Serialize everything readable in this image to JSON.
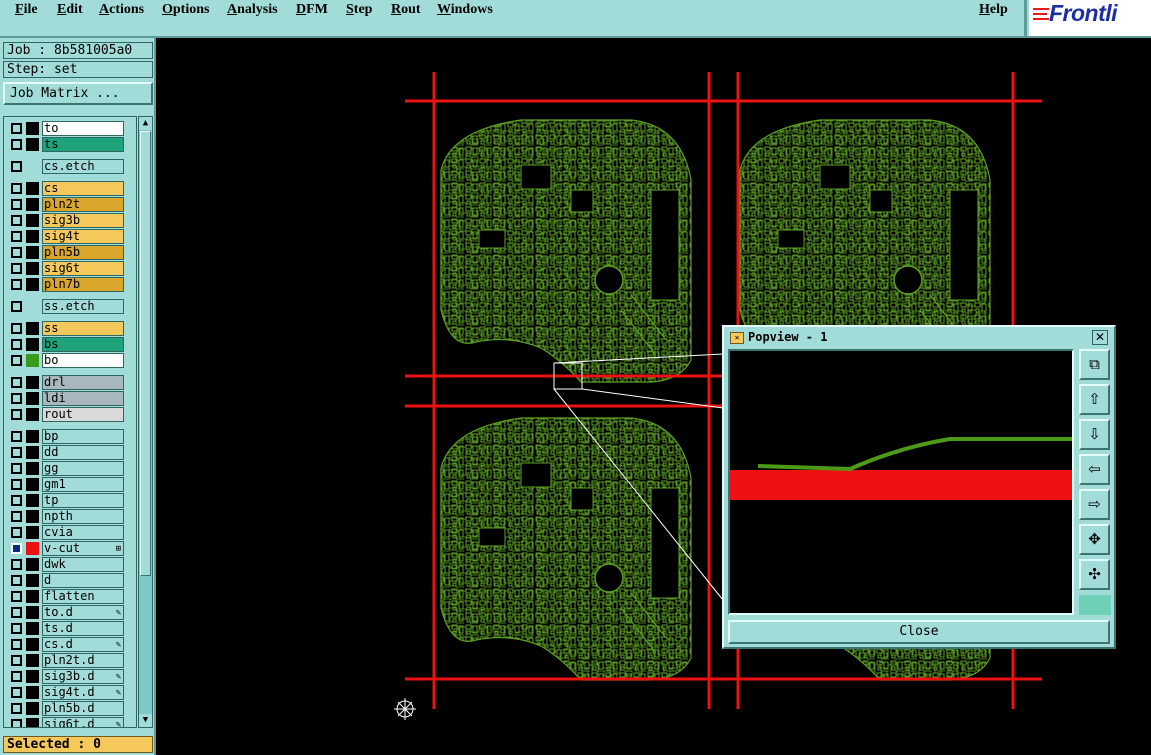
{
  "menubar": {
    "items": [
      "File",
      "Edit",
      "Actions",
      "Options",
      "Analysis",
      "DFM",
      "Step",
      "Rout",
      "Windows"
    ],
    "help": "Help",
    "logo_text": "Frontli"
  },
  "job": {
    "job_label": "Job : 8b581005a0",
    "step_label": "Step: set",
    "job_matrix_button": "Job Matrix ..."
  },
  "layers": [
    {
      "name": "to",
      "color": "#ffffff",
      "swatch": "#000000"
    },
    {
      "name": "ts",
      "color": "#1ea37a",
      "swatch": "#000000"
    },
    {
      "name": "cs.etch",
      "color": "#a2dcd9",
      "swatch": "",
      "gap_before": true
    },
    {
      "name": "cs",
      "color": "#f5c85c",
      "swatch": "#000000",
      "gap_before": true
    },
    {
      "name": "pln2t",
      "color": "#d9a52a",
      "swatch": "#000000"
    },
    {
      "name": "sig3b",
      "color": "#f5c85c",
      "swatch": "#000000"
    },
    {
      "name": "sig4t",
      "color": "#f5c85c",
      "swatch": "#000000"
    },
    {
      "name": "pln5b",
      "color": "#d9a52a",
      "swatch": "#000000"
    },
    {
      "name": "sig6t",
      "color": "#f5c85c",
      "swatch": "#000000"
    },
    {
      "name": "pln7b",
      "color": "#d9a52a",
      "swatch": "#000000"
    },
    {
      "name": "ss.etch",
      "color": "#a2dcd9",
      "swatch": "",
      "gap_before": true
    },
    {
      "name": "ss",
      "color": "#f5c85c",
      "swatch": "#000000",
      "gap_before": true
    },
    {
      "name": "bs",
      "color": "#1ea37a",
      "swatch": "#000000"
    },
    {
      "name": "bo",
      "color": "#ffffff",
      "swatch": "#3a9a1e"
    },
    {
      "name": "drl",
      "color": "#a8b7bd",
      "swatch": "#000000",
      "gap_before": true
    },
    {
      "name": "ldi",
      "color": "#a8b7bd",
      "swatch": "#000000"
    },
    {
      "name": "rout",
      "color": "#d9d9d9",
      "swatch": "#000000"
    },
    {
      "name": "bp",
      "color": "#a2dcd9",
      "swatch": "#000000",
      "gap_before": true
    },
    {
      "name": "dd",
      "color": "#a2dcd9",
      "swatch": "#000000"
    },
    {
      "name": "gg",
      "color": "#a2dcd9",
      "swatch": "#000000"
    },
    {
      "name": "gm1",
      "color": "#a2dcd9",
      "swatch": "#000000"
    },
    {
      "name": "tp",
      "color": "#a2dcd9",
      "swatch": "#000000"
    },
    {
      "name": "npth",
      "color": "#a2dcd9",
      "swatch": "#000000"
    },
    {
      "name": "cvia",
      "color": "#a2dcd9",
      "swatch": "#000000"
    },
    {
      "name": "v-cut",
      "color": "#a2dcd9",
      "swatch": "#ee1111",
      "active": true,
      "mark": "⊞"
    },
    {
      "name": "dwk",
      "color": "#a2dcd9",
      "swatch": "#000000"
    },
    {
      "name": "d",
      "color": "#a2dcd9",
      "swatch": "#000000"
    },
    {
      "name": "flatten",
      "color": "#a2dcd9",
      "swatch": "#000000"
    },
    {
      "name": "to.d",
      "color": "#a2dcd9",
      "swatch": "#000000",
      "mark": "✎"
    },
    {
      "name": "ts.d",
      "color": "#a2dcd9",
      "swatch": "#000000"
    },
    {
      "name": "cs.d",
      "color": "#a2dcd9",
      "swatch": "#000000",
      "mark": "✎"
    },
    {
      "name": "pln2t.d",
      "color": "#a2dcd9",
      "swatch": "#000000"
    },
    {
      "name": "sig3b.d",
      "color": "#a2dcd9",
      "swatch": "#000000",
      "mark": "✎"
    },
    {
      "name": "sig4t.d",
      "color": "#a2dcd9",
      "swatch": "#000000",
      "mark": "✎"
    },
    {
      "name": "pln5b.d",
      "color": "#a2dcd9",
      "swatch": "#000000"
    },
    {
      "name": "sig6t.d",
      "color": "#a2dcd9",
      "swatch": "#000000",
      "mark": "✎"
    }
  ],
  "status": {
    "selected": "Selected : 0"
  },
  "popview": {
    "title": "Popview - 1",
    "close_button": "Close",
    "tools": [
      "zoom-fit-icon",
      "pan-up-icon",
      "pan-down-icon",
      "pan-left-icon",
      "pan-right-icon",
      "zoom-out-icon",
      "zoom-in-icon"
    ]
  },
  "colors": {
    "panel": "#a2dcd9",
    "grid_line": "#ee1111",
    "copper": "#5ca025"
  }
}
